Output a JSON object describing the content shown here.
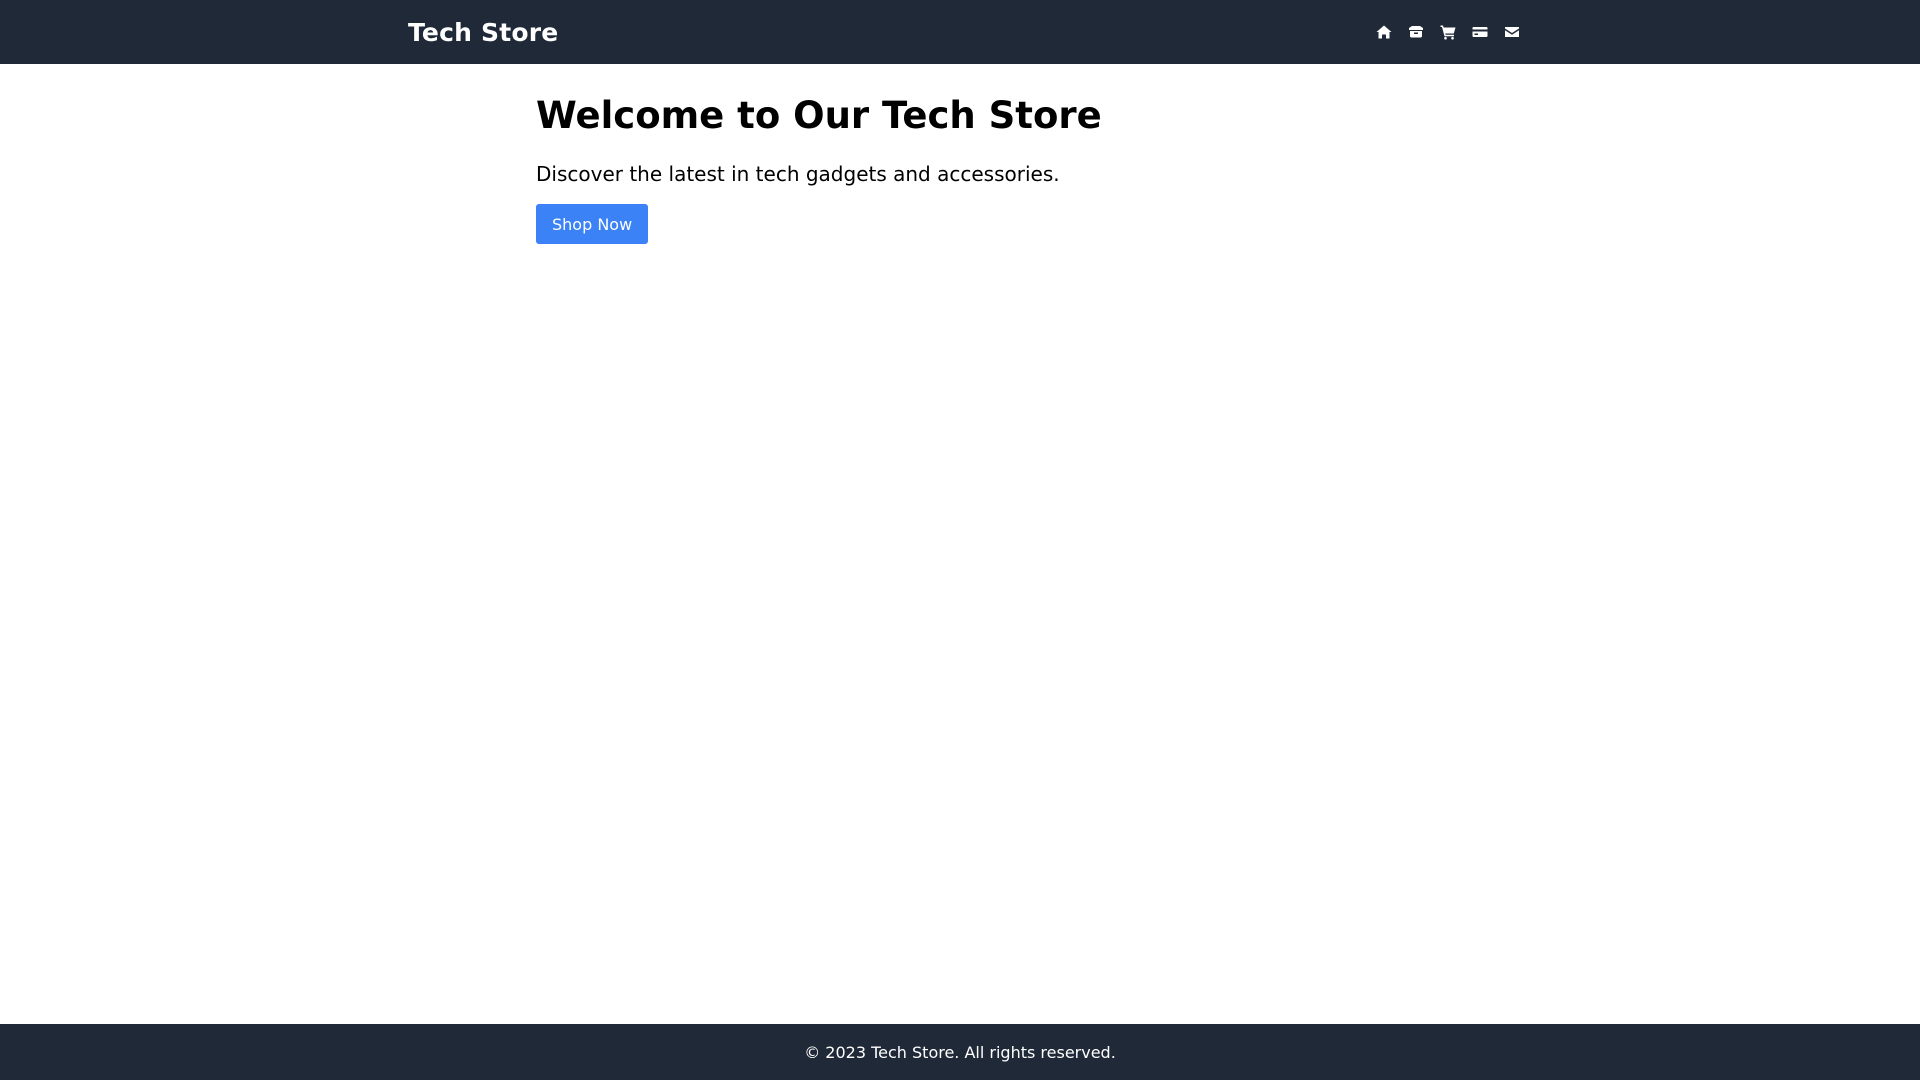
{
  "header": {
    "brand": "Tech Store",
    "nav_icons": [
      {
        "name": "home-icon"
      },
      {
        "name": "products-icon"
      },
      {
        "name": "cart-icon"
      },
      {
        "name": "payment-card-icon"
      },
      {
        "name": "mail-icon"
      }
    ]
  },
  "hero": {
    "title": "Welcome to Our Tech Store",
    "subtitle": "Discover the latest in tech gadgets and accessories.",
    "cta_label": "Shop Now"
  },
  "footer": {
    "copyright": "© 2023 Tech Store. All rights reserved."
  },
  "colors": {
    "nav_background": "#1f2937",
    "footer_background": "#1f2937",
    "accent": "#3b82f6",
    "page_background": "#ffffff"
  }
}
